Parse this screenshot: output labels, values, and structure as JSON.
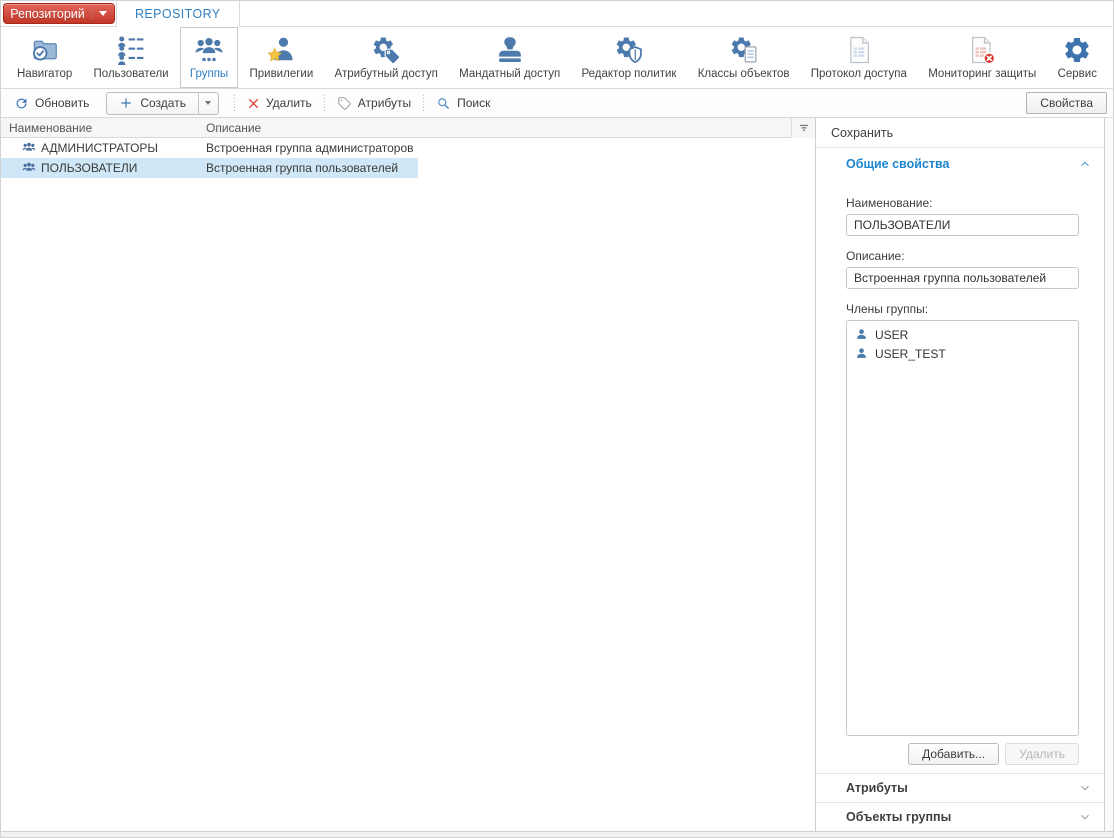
{
  "app": {
    "repository_button": "Репозиторий",
    "tab": "REPOSITORY"
  },
  "ribbon": {
    "items": [
      {
        "label": "Навигатор",
        "icon": "folder-check-icon",
        "selected": false
      },
      {
        "label": "Пользователи",
        "icon": "users-list-icon",
        "selected": false
      },
      {
        "label": "Группы",
        "icon": "user-group-icon",
        "selected": true
      },
      {
        "label": "Привилегии",
        "icon": "user-star-icon",
        "selected": false
      },
      {
        "label": "Атрибутный доступ",
        "icon": "gear-tag-icon",
        "selected": false
      },
      {
        "label": "Мандатный доступ",
        "icon": "stamp-icon",
        "selected": false
      },
      {
        "label": "Редактор политик",
        "icon": "gear-shield-icon",
        "selected": false
      },
      {
        "label": "Классы объектов",
        "icon": "gear-document-icon",
        "selected": false
      },
      {
        "label": "Протокол доступа",
        "icon": "document-table-icon",
        "selected": false
      },
      {
        "label": "Мониторинг защиты",
        "icon": "document-alert-icon",
        "selected": false
      },
      {
        "label": "Сервис",
        "icon": "gear-icon",
        "selected": false
      }
    ]
  },
  "toolbar": {
    "refresh": "Обновить",
    "create": "Создать",
    "delete": "Удалить",
    "attributes": "Атрибуты",
    "search": "Поиск",
    "properties": "Свойства"
  },
  "table": {
    "columns": [
      "Наименование",
      "Описание"
    ],
    "rows": [
      {
        "name": "АДМИНИСТРАТОРЫ",
        "description": "Встроенная группа администраторов",
        "selected": false
      },
      {
        "name": "ПОЛЬЗОВАТЕЛИ",
        "description": "Встроенная группа пользователей",
        "selected": true
      }
    ]
  },
  "panel": {
    "save_label": "Сохранить",
    "general_section": "Общие свойства",
    "name_label": "Наименование:",
    "name_value": "ПОЛЬЗОВАТЕЛИ",
    "description_label": "Описание:",
    "description_value": "Встроенная группа пользователей",
    "members_label": "Члены группы:",
    "members": [
      "USER",
      "USER_TEST"
    ],
    "add_button": "Добавить...",
    "remove_button": "Удалить",
    "attributes_section": "Атрибуты",
    "objects_section": "Объекты группы"
  },
  "colors": {
    "accent_red": "#c23727",
    "accent_blue": "#2b7cc1",
    "icon_blue": "#4d7aac",
    "row_selection": "#cfe7f6",
    "section_header_blue": "#1d86cf"
  }
}
